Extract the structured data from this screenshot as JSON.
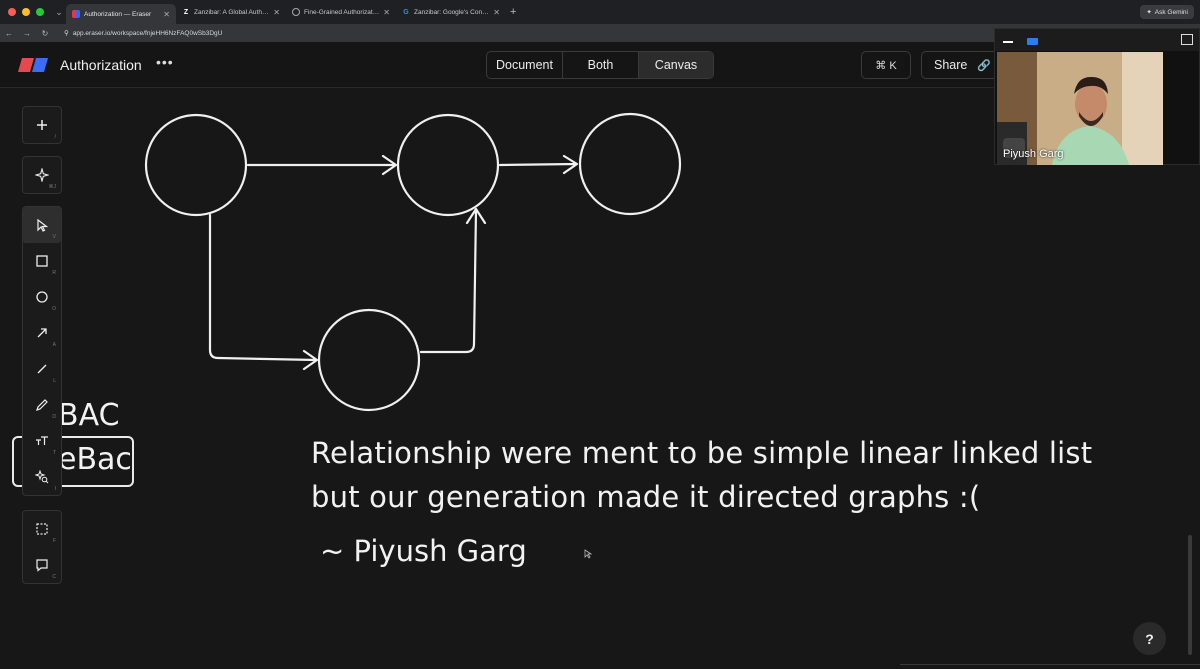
{
  "browser": {
    "tabs": [
      {
        "title": "Authorization — Eraser",
        "active": true,
        "favicon": "eraser"
      },
      {
        "title": "Zanzibar: A Global Authorizat",
        "active": false,
        "favicon": "Z"
      },
      {
        "title": "Fine-Grained Authorization |",
        "active": false,
        "favicon": "globe"
      },
      {
        "title": "Zanzibar: Google's Consister",
        "active": false,
        "favicon": "G"
      }
    ],
    "ask_gemini": "Ask Gemini",
    "url": "app.eraser.io/workspace/fnjeHH6NzFAQ0wSb3DgU"
  },
  "header": {
    "title": "Authorization",
    "view_tabs": [
      "Document",
      "Both",
      "Canvas"
    ],
    "active_view": "Canvas",
    "shortcut_label": "⌘ K",
    "share_label": "Share"
  },
  "canvas": {
    "note_line1": "Relationship were ment to be simple linear linked list",
    "note_line2": "but our generation made it directed graphs :(",
    "signature": "~ Piyush Garg",
    "partial_text_1": "BAC",
    "partial_text_2": "eBac"
  },
  "toolbar": {
    "top": [
      {
        "icon": "plus-icon",
        "hotkey": "/"
      }
    ],
    "ai": [
      {
        "icon": "sparkle-icon",
        "hotkey": "⌘J"
      }
    ],
    "main": [
      {
        "icon": "pointer-icon",
        "hotkey": "V"
      },
      {
        "icon": "rectangle-icon",
        "hotkey": "R"
      },
      {
        "icon": "circle-icon",
        "hotkey": "O"
      },
      {
        "icon": "arrow-icon",
        "hotkey": "A"
      },
      {
        "icon": "line-icon",
        "hotkey": "L"
      },
      {
        "icon": "pencil-icon",
        "hotkey": "D"
      },
      {
        "icon": "text-icon",
        "hotkey": "T"
      },
      {
        "icon": "shape-search-icon",
        "hotkey": "I"
      }
    ],
    "bottom": [
      {
        "icon": "frame-icon",
        "hotkey": "F"
      },
      {
        "icon": "comment-icon",
        "hotkey": "C"
      }
    ]
  },
  "video": {
    "participant": "Piyush Garg"
  },
  "help_label": "?"
}
